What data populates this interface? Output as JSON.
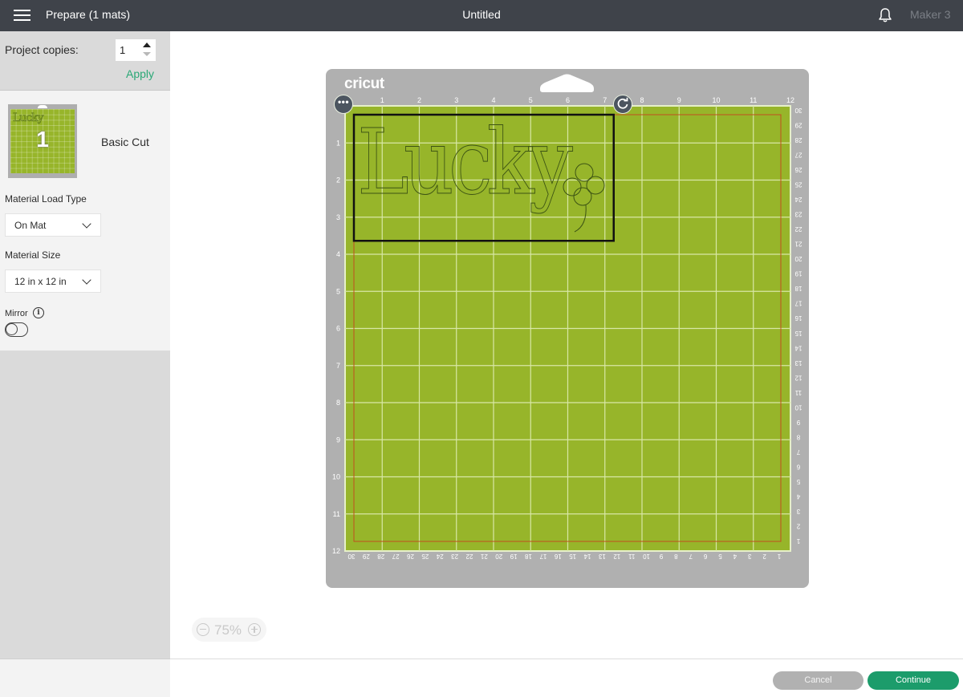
{
  "header": {
    "menu_icon": "hamburger-icon",
    "title": "Prepare (1 mats)",
    "document_title": "Untitled",
    "notification_icon": "bell-icon",
    "machine": "Maker 3"
  },
  "sidebar": {
    "project_copies_label": "Project copies:",
    "project_copies_value": "1",
    "apply_label": "Apply",
    "mats": [
      {
        "number": "1",
        "name": "Basic Cut",
        "thumbnail_text": "Lucky"
      }
    ],
    "material_load_type_label": "Material Load Type",
    "material_load_type_value": "On Mat",
    "material_size_label": "Material Size",
    "material_size_value": "12 in x 12 in",
    "mirror_label": "Mirror",
    "mirror_on": false,
    "info_icon": "info-icon"
  },
  "mat": {
    "brand": "cricut",
    "color": "#97b52a",
    "size_in": 12,
    "top_ruler": [
      "1",
      "2",
      "3",
      "4",
      "5",
      "6",
      "7",
      "8",
      "9",
      "10",
      "11",
      "12"
    ],
    "left_ruler": [
      "1",
      "2",
      "3",
      "4",
      "5",
      "6",
      "7",
      "8",
      "9",
      "10",
      "11",
      "12"
    ],
    "right_ruler_cm": [
      "30",
      "29",
      "28",
      "27",
      "26",
      "25",
      "24",
      "23",
      "22",
      "21",
      "20",
      "19",
      "18",
      "17",
      "16",
      "15",
      "14",
      "13",
      "12",
      "11",
      "10",
      "9",
      "8",
      "7",
      "6",
      "5",
      "4",
      "3",
      "2",
      "1"
    ],
    "bottom_ruler_cm": [
      "30",
      "29",
      "28",
      "27",
      "26",
      "25",
      "24",
      "23",
      "22",
      "21",
      "20",
      "19",
      "18",
      "17",
      "16",
      "15",
      "14",
      "13",
      "12",
      "11",
      "10",
      "9",
      "8",
      "7",
      "6",
      "5",
      "4",
      "3",
      "2",
      "1"
    ],
    "design_text": "Lucky",
    "design_extent_in": {
      "width": 7.0,
      "height": 3.4
    },
    "more_icon": "more-options-icon",
    "rotate_icon": "rotate-icon"
  },
  "zoom": {
    "value": "75%",
    "zoom_out_icon": "zoom-out-icon",
    "zoom_in_icon": "zoom-in-icon"
  },
  "footer": {
    "cancel_label": "Cancel",
    "continue_label": "Continue"
  },
  "colors": {
    "header": "#3f434a",
    "accent": "#2aa876",
    "continue": "#1c9c6b",
    "mat_green": "#97b52a",
    "mat_gray": "#b0b0b0",
    "cut_margin": "#c0501d"
  }
}
